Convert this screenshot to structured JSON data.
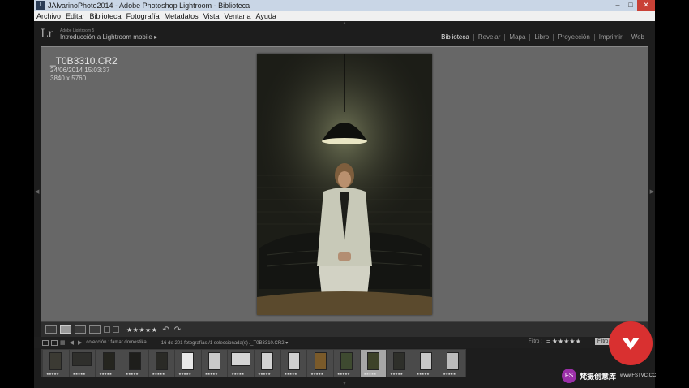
{
  "window": {
    "title": "JAlvarinoPhoto2014 - Adobe Photoshop Lightroom - Biblioteca",
    "minimize": "–",
    "maximize": "□",
    "close": "✕"
  },
  "menu": [
    "Archivo",
    "Editar",
    "Biblioteca",
    "Fotografía",
    "Metadatos",
    "Vista",
    "Ventana",
    "Ayuda"
  ],
  "identity": {
    "logo": "Lr",
    "product": "Adobe Lightroom 5",
    "catalog": "Introducción a Lightroom mobile ▸"
  },
  "modules": [
    "Biblioteca",
    "Revelar",
    "Mapa",
    "Libro",
    "Proyección",
    "Imprimir",
    "Web"
  ],
  "active_module": "Biblioteca",
  "photo_info": {
    "filename": "_T0B3310.CR2",
    "date": "24/06/2014 15:03:37",
    "dimensions": "3840 x 5760"
  },
  "toolbar": {
    "rating": "★★★★★"
  },
  "filmstrip_bar": {
    "source": "colección : famar domestika",
    "count": "16 de 201 fotografías /1 seleccionada(s) /_T0B3310.CR2 ▾",
    "filter_label": "Filtro :",
    "filter_stars": "= ★★★★★",
    "filter_toggle": "Filtro"
  },
  "filmstrip": {
    "thumb_rating": "★★★★★",
    "thumbs": [
      {
        "orient": "portrait",
        "tone": "#3b3a33"
      },
      {
        "orient": "landscape",
        "tone": "#2f2f2c"
      },
      {
        "orient": "portrait",
        "tone": "#25251f"
      },
      {
        "orient": "portrait",
        "tone": "#1e1e1b"
      },
      {
        "orient": "portrait",
        "tone": "#2a2a26"
      },
      {
        "orient": "portrait",
        "tone": "#e8e8e8"
      },
      {
        "orient": "portrait",
        "tone": "#c9c9c9"
      },
      {
        "orient": "landscape",
        "tone": "#d6d6d6"
      },
      {
        "orient": "portrait",
        "tone": "#d2d2d2"
      },
      {
        "orient": "portrait",
        "tone": "#cfcfcf"
      },
      {
        "orient": "portrait",
        "tone": "#7a5a2a"
      },
      {
        "orient": "portrait",
        "tone": "#3e4a30"
      },
      {
        "orient": "portrait",
        "tone": "#3d4229"
      },
      {
        "orient": "portrait",
        "tone": "#2e2f2a"
      },
      {
        "orient": "portrait",
        "tone": "#c8c8c8"
      },
      {
        "orient": "portrait",
        "tone": "#bcbcbc"
      }
    ],
    "selected_index": 12
  },
  "watermark": {
    "logo": "FS",
    "name": "梵摄创意库",
    "url": "www.FSTVC.CC"
  },
  "colors": {
    "accent_red": "#d93030",
    "panel_bg": "#1d1d1d",
    "loupe_bg": "#676767"
  }
}
